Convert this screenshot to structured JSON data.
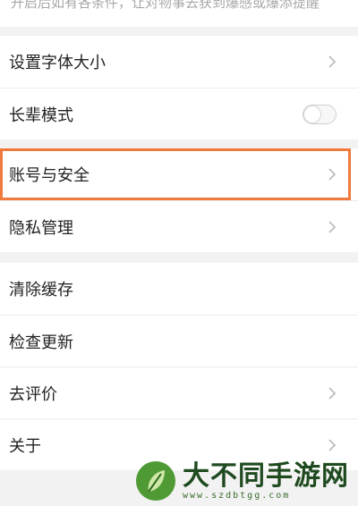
{
  "top_note": "开启后如有各条件，让对物事去获到爆感或爆添提醒",
  "settings_groups": [
    {
      "items": [
        {
          "label": "设置字体大小",
          "control": "chevron-right-icon"
        },
        {
          "label": "长辈模式",
          "control": "toggle",
          "toggle_on": false
        }
      ]
    },
    {
      "items": [
        {
          "label": "账号与安全",
          "control": "chevron-right-icon",
          "highlighted": true
        },
        {
          "label": "隐私管理",
          "control": "chevron-right-icon"
        }
      ]
    },
    {
      "items": [
        {
          "label": "清除缓存",
          "control": "none"
        },
        {
          "label": "检查更新",
          "control": "none"
        },
        {
          "label": "去评价",
          "control": "chevron-right-icon"
        },
        {
          "label": "关于",
          "control": "chevron-right-icon"
        }
      ]
    }
  ],
  "watermark": {
    "title": "大不同手游网",
    "url": "www.szdbtgg.com",
    "logo_icon": "leaf-logo-icon"
  },
  "colors": {
    "highlight_border": "#f07a3c",
    "page_background": "#f2f2f2",
    "row_background": "#ffffff",
    "chevron": "#bdbdbd",
    "watermark_green": "#3f8f2f"
  }
}
